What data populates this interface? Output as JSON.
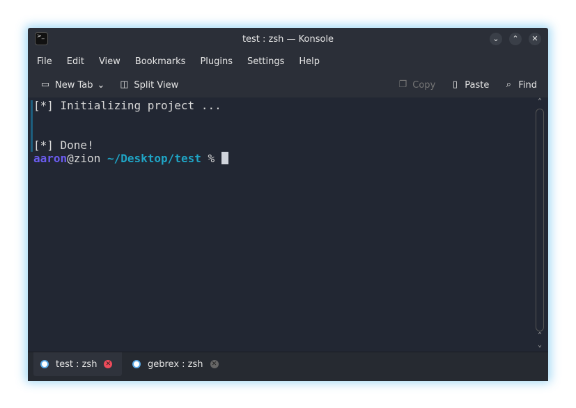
{
  "window": {
    "title": "test : zsh — Konsole"
  },
  "menu": [
    "File",
    "Edit",
    "View",
    "Bookmarks",
    "Plugins",
    "Settings",
    "Help"
  ],
  "toolbar": {
    "new_tab": "New Tab",
    "split_view": "Split View",
    "copy": "Copy",
    "paste": "Paste",
    "find": "Find"
  },
  "terminal": {
    "line1": "[*] Initializing project ...",
    "line2": "[*] Done!",
    "user": "aaron",
    "host": "@zion",
    "path": "~/Desktop/test",
    "prompt": "%"
  },
  "tabs": [
    {
      "label": "test : zsh"
    },
    {
      "label": "gebrex : zsh"
    }
  ]
}
